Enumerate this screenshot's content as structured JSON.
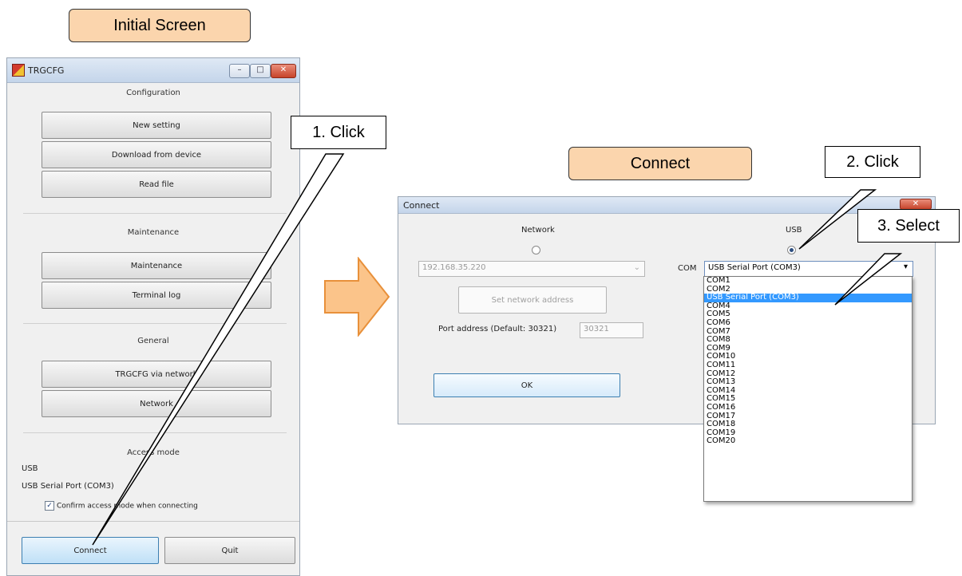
{
  "labels": {
    "initial_screen": "Initial Screen",
    "connect": "Connect"
  },
  "callouts": {
    "step1": "1. Click",
    "step2": "2. Click",
    "step3": "3. Select"
  },
  "main_window": {
    "title": "TRGCFG",
    "sections": {
      "configuration": "Configuration",
      "maintenance": "Maintenance",
      "general": "General",
      "access_mode": "Access mode"
    },
    "buttons": {
      "new_setting": "New setting",
      "download": "Download from device",
      "read_file": "Read file",
      "maintenance": "Maintenance",
      "terminal_log": "Terminal log",
      "trgcfg_network": "TRGCFG via network",
      "network": "Network",
      "connect": "Connect",
      "quit": "Quit"
    },
    "access": {
      "mode": "USB",
      "port": "USB Serial Port (COM3)",
      "confirm_label": "Confirm access mode when connecting",
      "confirm_checked": true
    }
  },
  "connect_window": {
    "title": "Connect",
    "network_label": "Network",
    "usb_label": "USB",
    "selected_mode": "USB",
    "ip_address": "192.168.35.220",
    "set_network_button": "Set network address",
    "port_label": "Port address (Default: 30321)",
    "port_value": "30321",
    "ok_button": "OK",
    "com_label": "COM",
    "com_selected": "USB Serial Port (COM3)",
    "com_options": [
      "COM1",
      "COM2",
      "USB Serial Port (COM3)",
      "COM4",
      "COM5",
      "COM6",
      "COM7",
      "COM8",
      "COM9",
      "COM10",
      "COM11",
      "COM12",
      "COM13",
      "COM14",
      "COM15",
      "COM16",
      "COM17",
      "COM18",
      "COM19",
      "COM20"
    ]
  },
  "colors": {
    "label_fill": "#fbd5ad",
    "arrow_fill": "#fbc48a",
    "arrow_stroke": "#e8903a",
    "selection": "#3399ff"
  }
}
